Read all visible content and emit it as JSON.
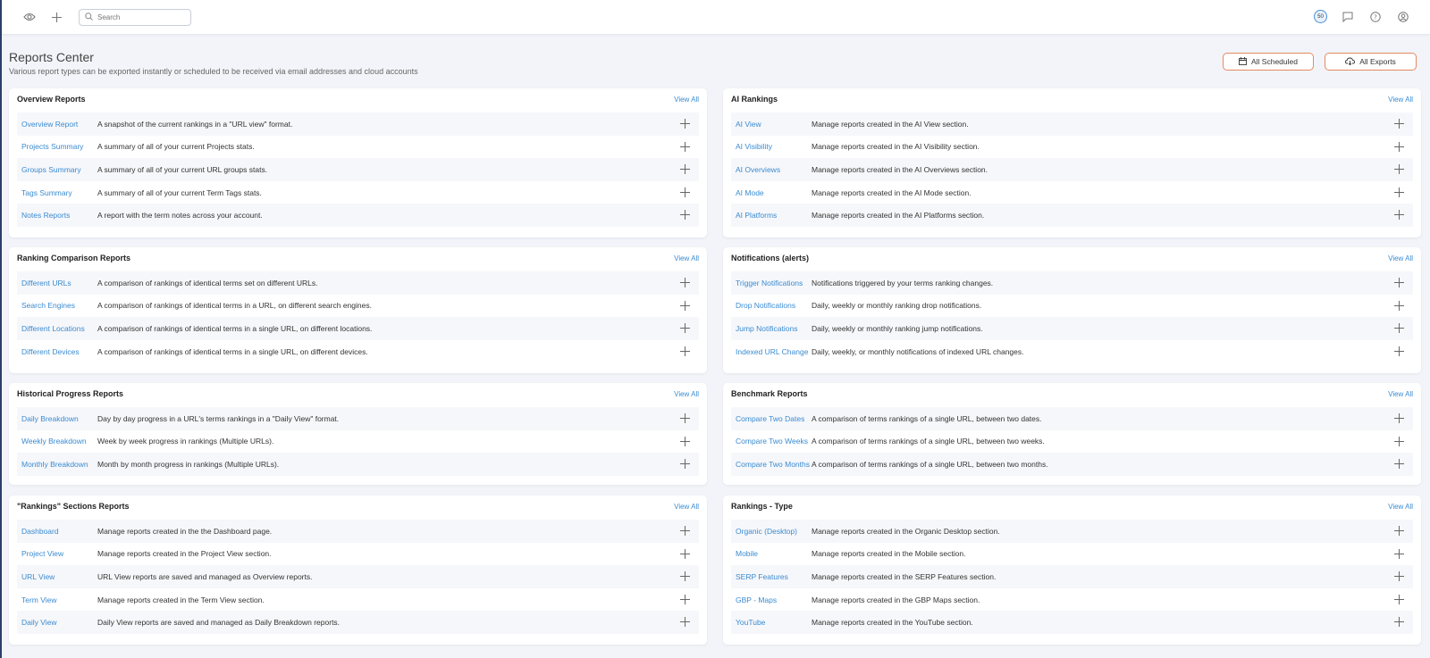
{
  "topbar": {
    "search_placeholder": "Search",
    "badge_value": "50",
    "icons": [
      "eye-icon",
      "plus-icon",
      "search-icon",
      "chat-icon",
      "help-icon",
      "user-icon"
    ]
  },
  "header": {
    "title": "Reports Center",
    "subtitle": "Various report types can be exported instantly or scheduled to be received via email addresses and cloud accounts",
    "all_scheduled": "All Scheduled",
    "all_exports": "All Exports"
  },
  "colors": {
    "link": "#3a8bd1",
    "accent_border": "#e58a5e",
    "badge_ring": "#4a90d9"
  },
  "sections": [
    {
      "title": "Overview Reports",
      "view_all": "View All",
      "rows": [
        {
          "name": "Overview Report",
          "desc": "A snapshot of the current rankings in a \"URL view\" format."
        },
        {
          "name": "Projects Summary",
          "desc": "A summary of all of your current Projects stats."
        },
        {
          "name": "Groups Summary",
          "desc": "A summary of all of your current URL groups stats."
        },
        {
          "name": "Tags Summary",
          "desc": "A summary of all of your current Term Tags stats."
        },
        {
          "name": "Notes Reports",
          "desc": "A report with the term notes across your account."
        }
      ]
    },
    {
      "title": "AI Rankings",
      "view_all": "View All",
      "rows": [
        {
          "name": "AI View",
          "desc": "Manage reports created in the AI View section."
        },
        {
          "name": "AI Visibility",
          "desc": "Manage reports created in the AI Visibility section."
        },
        {
          "name": "AI Overviews",
          "desc": "Manage reports created in the AI Overviews section."
        },
        {
          "name": "AI Mode",
          "desc": "Manage reports created in the AI Mode section."
        },
        {
          "name": "AI Platforms",
          "desc": "Manage reports created in the AI Platforms section."
        }
      ]
    },
    {
      "title": "Ranking Comparison Reports",
      "view_all": "View All",
      "rows": [
        {
          "name": "Different URLs",
          "desc": "A comparison of rankings of identical terms set on different URLs."
        },
        {
          "name": "Search Engines",
          "desc": "A comparison of rankings of identical terms in a URL, on different search engines."
        },
        {
          "name": "Different Locations",
          "desc": "A comparison of rankings of identical terms in a single URL, on different locations."
        },
        {
          "name": "Different Devices",
          "desc": "A comparison of rankings of identical terms in a single URL, on different devices."
        }
      ]
    },
    {
      "title": "Notifications (alerts)",
      "view_all": "View All",
      "rows": [
        {
          "name": "Trigger Notifications",
          "desc": "Notifications triggered by your terms ranking changes."
        },
        {
          "name": "Drop Notifications",
          "desc": "Daily, weekly or monthly ranking drop notifications."
        },
        {
          "name": "Jump Notifications",
          "desc": "Daily, weekly or monthly ranking jump notifications."
        },
        {
          "name": "Indexed URL Change",
          "desc": "Daily, weekly, or monthly notifications of indexed URL changes."
        }
      ]
    },
    {
      "title": "Historical Progress Reports",
      "view_all": "View All",
      "rows": [
        {
          "name": "Daily Breakdown",
          "desc": "Day by day progress in a URL's terms rankings in a \"Daily View\" format."
        },
        {
          "name": "Weekly Breakdown",
          "desc": "Week by week progress in rankings (Multiple URLs)."
        },
        {
          "name": "Monthly Breakdown",
          "desc": "Month by month progress in rankings (Multiple URLs)."
        }
      ]
    },
    {
      "title": "Benchmark Reports",
      "view_all": "View All",
      "rows": [
        {
          "name": "Compare Two Dates",
          "desc": "A comparison of terms rankings of a single URL, between two dates."
        },
        {
          "name": "Compare Two Weeks",
          "desc": "A comparison of terms rankings of a single URL, between two weeks."
        },
        {
          "name": "Compare Two Months",
          "desc": "A comparison of terms rankings of a single URL, between two months."
        }
      ]
    },
    {
      "title": "\"Rankings\" Sections Reports",
      "view_all": "View All",
      "rows": [
        {
          "name": "Dashboard",
          "desc": "Manage reports created in the the Dashboard page."
        },
        {
          "name": "Project View",
          "desc": "Manage reports created in the Project View section."
        },
        {
          "name": "URL View",
          "desc": "URL View reports are saved and managed as Overview reports."
        },
        {
          "name": "Term View",
          "desc": "Manage reports created in the Term View section."
        },
        {
          "name": "Daily View",
          "desc": "Daily View reports are saved and managed as Daily Breakdown reports."
        }
      ]
    },
    {
      "title": "Rankings - Type",
      "view_all": "View All",
      "rows": [
        {
          "name": "Organic (Desktop)",
          "desc": "Manage reports created in the Organic Desktop section."
        },
        {
          "name": "Mobile",
          "desc": "Manage reports created in the Mobile section."
        },
        {
          "name": "SERP Features",
          "desc": "Manage reports created in the SERP Features section."
        },
        {
          "name": "GBP - Maps",
          "desc": "Manage reports created in the GBP Maps section."
        },
        {
          "name": "YouTube",
          "desc": "Manage reports created in the YouTube section."
        }
      ]
    }
  ]
}
